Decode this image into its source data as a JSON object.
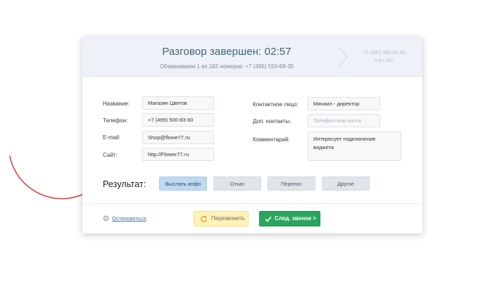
{
  "header": {
    "title": "Разговор завершен:  02:57",
    "subtitle": "Обзваниваем 1 из 182 номеров: +7 (495) 550-69-35",
    "next_number": "+7 (495) 550-69-35",
    "next_index": "2 из 182"
  },
  "fields_left": [
    {
      "label": "Название:",
      "value": "Магазин Цветов"
    },
    {
      "label": "Телефон:",
      "value": "+7 (499) 500-83-60"
    },
    {
      "label": "E-mail:",
      "value": "Shop@flowe77.ru"
    },
    {
      "label": "Сайт:",
      "value": "http://Flower77.ru"
    }
  ],
  "fields_right": [
    {
      "label": "Контактное лицо:",
      "value": "Михаил - директор"
    },
    {
      "label": "Доп. контакты.",
      "value": "",
      "placeholder": "Телефон или почта"
    },
    {
      "label": "Комментарий:",
      "value": "Интересует подключение виджета"
    }
  ],
  "result": {
    "label": "Результат:",
    "buttons": [
      "Выслать инфо",
      "Отказ",
      "Перенос",
      "Другое"
    ],
    "active_index": 0
  },
  "footer": {
    "stop_label": "Остановиться",
    "redial_label": "Перезвонить",
    "next_call_label": "След. звонок >"
  },
  "colors": {
    "header_bg": "#eef1f8",
    "active_result": "#bfd9f0",
    "redial_bg": "#fff3b8",
    "next_bg": "#2aa55e",
    "arrow": "#d93a3a"
  },
  "icons": {
    "next": "chevron-right-icon",
    "stop": "stop-circle-icon",
    "redial": "refresh-icon",
    "next_call": "check-icon"
  }
}
